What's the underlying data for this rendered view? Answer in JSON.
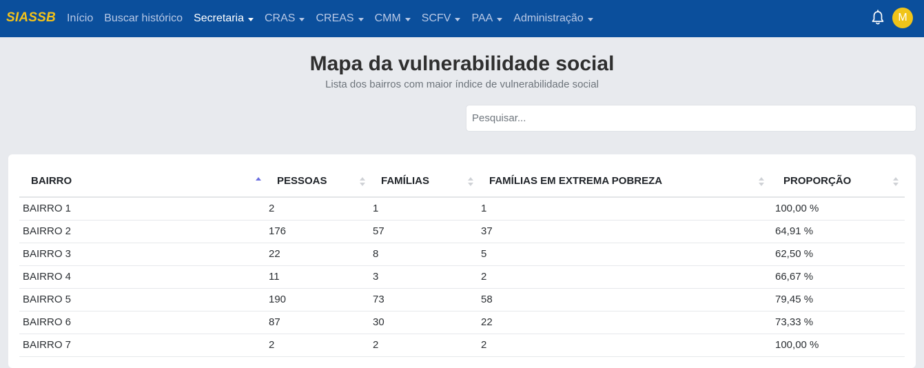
{
  "brand": "SIASSB",
  "nav": [
    {
      "label": "Início",
      "dropdown": false,
      "active": false
    },
    {
      "label": "Buscar histórico",
      "dropdown": false,
      "active": false
    },
    {
      "label": "Secretaria",
      "dropdown": true,
      "active": true
    },
    {
      "label": "CRAS",
      "dropdown": true,
      "active": false
    },
    {
      "label": "CREAS",
      "dropdown": true,
      "active": false
    },
    {
      "label": "CMM",
      "dropdown": true,
      "active": false
    },
    {
      "label": "SCFV",
      "dropdown": true,
      "active": false
    },
    {
      "label": "PAA",
      "dropdown": true,
      "active": false
    },
    {
      "label": "Administração",
      "dropdown": true,
      "active": false
    }
  ],
  "user": {
    "avatar_initial": "M"
  },
  "icons": {
    "notifications": "bell-icon",
    "sort": "sort-arrows-icon"
  },
  "colors": {
    "navbar": "#0b4f9c",
    "brand": "#f4c21a",
    "avatar": "#f0c419",
    "sort_active": "#6a6ee0"
  },
  "page": {
    "title": "Mapa da vulnerabilidade social",
    "subtitle": "Lista dos bairros com maior índice de vulnerabilidade social"
  },
  "search": {
    "placeholder": "Pesquisar...",
    "value": ""
  },
  "table": {
    "columns": [
      {
        "label": "BAIRRO",
        "sort": "asc"
      },
      {
        "label": "PESSOAS",
        "sort": "none"
      },
      {
        "label": "FAMÍLIAS",
        "sort": "none"
      },
      {
        "label": "FAMÍLIAS EM EXTREMA POBREZA",
        "sort": "none"
      },
      {
        "label": "PROPORÇÃO",
        "sort": "none"
      }
    ],
    "rows": [
      [
        "BAIRRO 1",
        "2",
        "1",
        "1",
        "100,00 %"
      ],
      [
        "BAIRRO 2",
        "176",
        "57",
        "37",
        "64,91 %"
      ],
      [
        "BAIRRO 3",
        "22",
        "8",
        "5",
        "62,50 %"
      ],
      [
        "BAIRRO 4",
        "11",
        "3",
        "2",
        "66,67 %"
      ],
      [
        "BAIRRO 5",
        "190",
        "73",
        "58",
        "79,45 %"
      ],
      [
        "BAIRRO 6",
        "87",
        "30",
        "22",
        "73,33 %"
      ],
      [
        "BAIRRO 7",
        "2",
        "2",
        "2",
        "100,00 %"
      ]
    ]
  }
}
